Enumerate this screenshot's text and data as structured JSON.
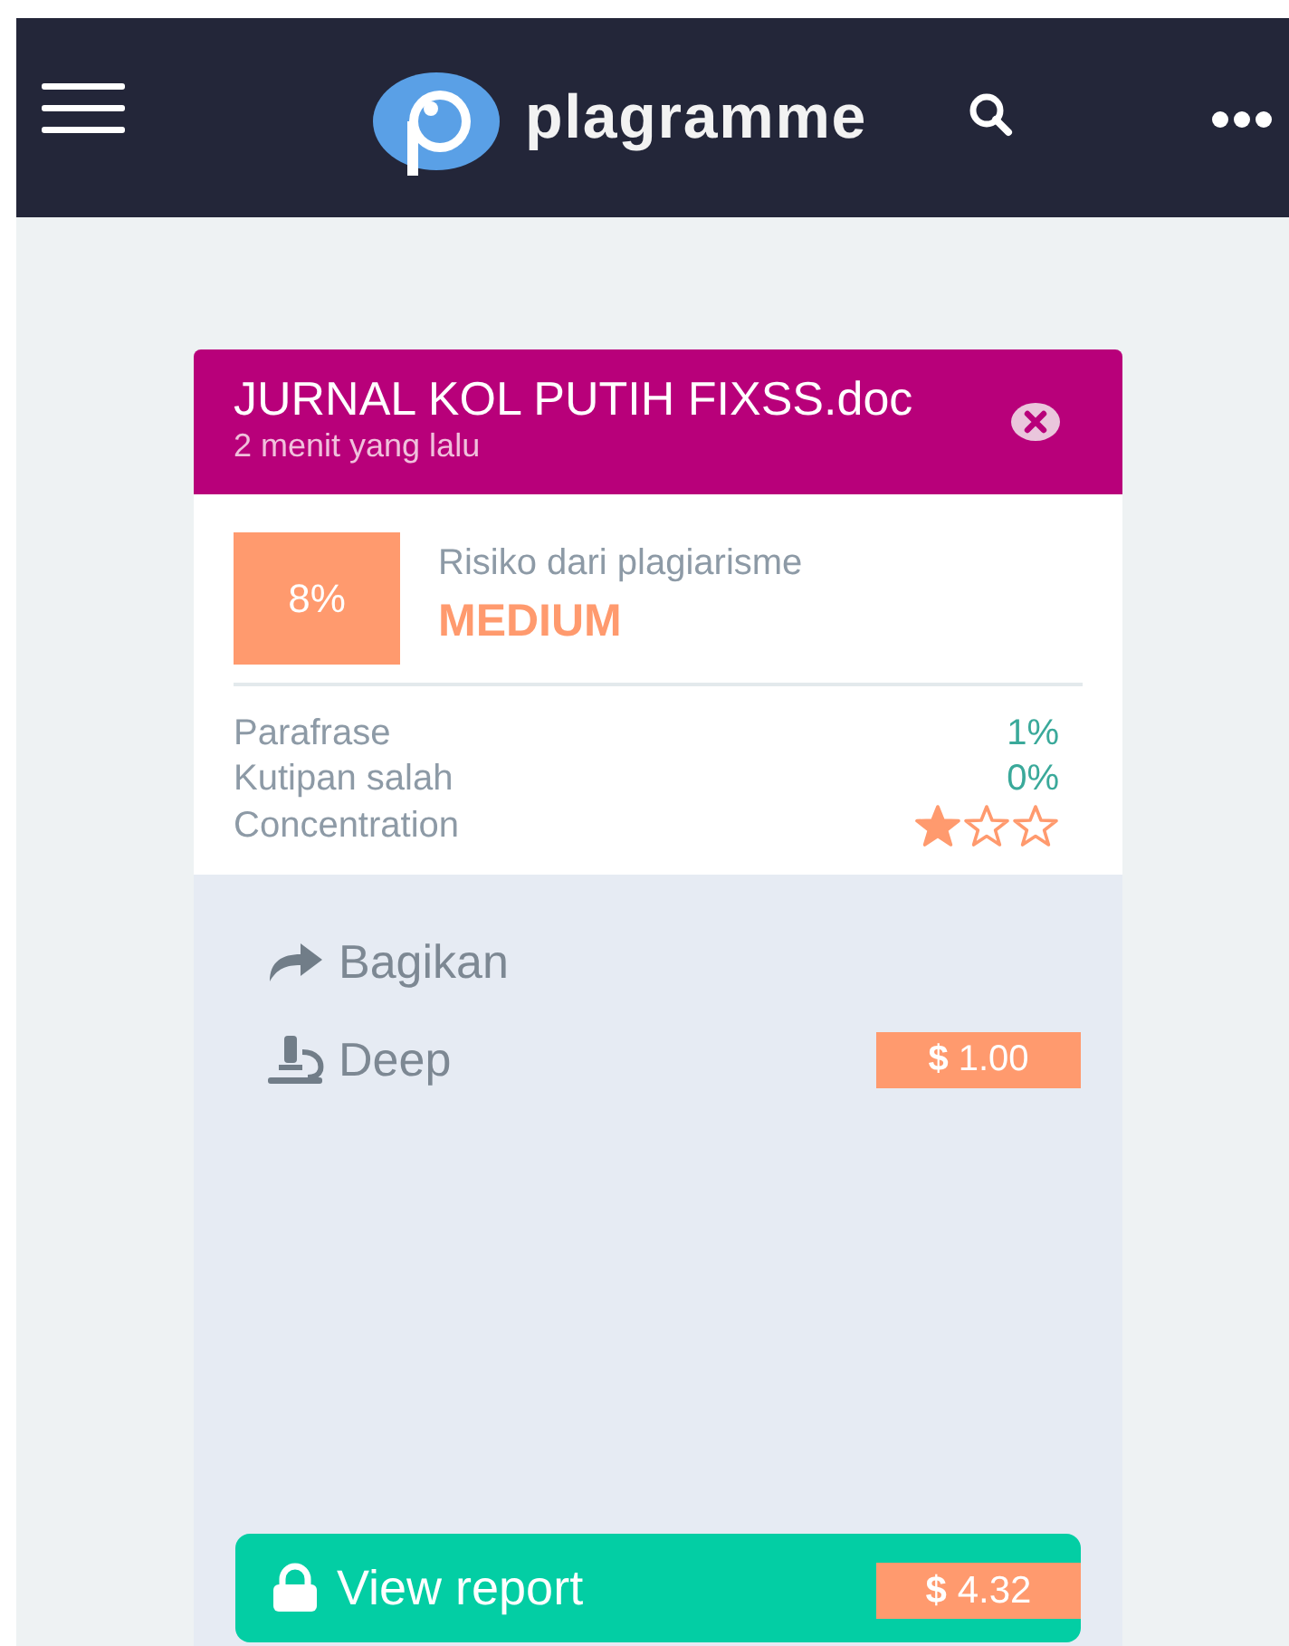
{
  "header": {
    "app_name": "plagramme"
  },
  "document": {
    "title": "JURNAL KOL PUTIH FIXSS.doc",
    "time": "2 menit yang lalu"
  },
  "risk": {
    "percent": "8%",
    "label": "Risiko dari plagiarisme",
    "level_text": "MEDIUM"
  },
  "metrics": [
    {
      "kind": "value",
      "label": "Parafrase",
      "value": "1%"
    },
    {
      "kind": "value",
      "label": "Kutipan salah",
      "value": "0%"
    },
    {
      "kind": "stars",
      "label": "Concentration",
      "stars": 1
    }
  ],
  "actions": [
    {
      "kind": "share",
      "label": "Bagikan"
    },
    {
      "kind": "deep",
      "label": "Deep",
      "price": "**$** 1.00"
    }
  ],
  "report_button": {
    "label": "View report",
    "price": "**$** 4.32"
  }
}
